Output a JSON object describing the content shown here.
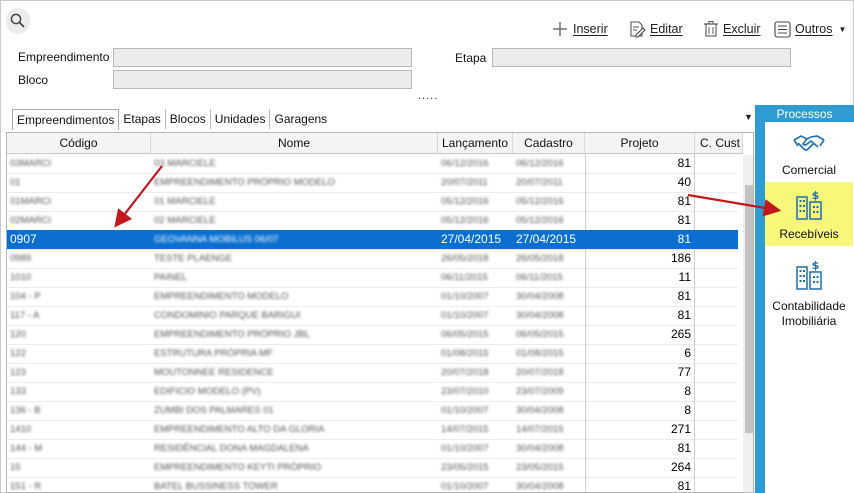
{
  "toolbar": {
    "insert": "Inserir",
    "edit": "Editar",
    "delete": "Excluir",
    "others": "Outros"
  },
  "filters": {
    "empreendimento_label": "Empreendimento",
    "bloco_label": "Bloco",
    "etapa_label": "Etapa",
    "empreendimento_value": "",
    "bloco_value": "",
    "etapa_value": "",
    "expand": "....."
  },
  "tabs": [
    "Empreendimentos",
    "Etapas",
    "Blocos",
    "Unidades",
    "Garagens"
  ],
  "table": {
    "headers": [
      "Código",
      "Nome",
      "Lançamento",
      "Cadastro",
      "Projeto",
      "C. Cust"
    ],
    "rows": [
      {
        "codigo": "03MARCI",
        "nome": "03 MARCIELE",
        "lancamento": "06/12/2016",
        "cadastro": "06/12/2016",
        "projeto": "81"
      },
      {
        "codigo": "01",
        "nome": "EMPREENDIMENTO PRÓPRIO MODELO",
        "lancamento": "20/07/2011",
        "cadastro": "20/07/2011",
        "projeto": "40"
      },
      {
        "codigo": "01MARCI",
        "nome": "01 MARCIELE",
        "lancamento": "05/12/2016",
        "cadastro": "05/12/2016",
        "projeto": "81"
      },
      {
        "codigo": "02MARCI",
        "nome": "02 MARCIELE",
        "lancamento": "05/12/2016",
        "cadastro": "05/12/2016",
        "projeto": "81"
      },
      {
        "codigo": "0907",
        "nome": "GEOVANNA MOBILUS 06/07",
        "lancamento": "27/04/2015",
        "cadastro": "27/04/2015",
        "projeto": "81",
        "selected": true
      },
      {
        "codigo": "0989",
        "nome": "TESTE PLAENGE",
        "lancamento": "26/05/2018",
        "cadastro": "26/05/2018",
        "projeto": "186"
      },
      {
        "codigo": "1010",
        "nome": "PAINEL",
        "lancamento": "06/11/2015",
        "cadastro": "06/11/2015",
        "projeto": "11"
      },
      {
        "codigo": "104 - P",
        "nome": "EMPREENDIMENTO MODELO",
        "lancamento": "01/10/2007",
        "cadastro": "30/04/2008",
        "projeto": "81"
      },
      {
        "codigo": "117 - A",
        "nome": "CONDOMINIO PARQUE BARIGUI",
        "lancamento": "01/10/2007",
        "cadastro": "30/04/2008",
        "projeto": "81"
      },
      {
        "codigo": "120",
        "nome": "EMPREENDIMENTO PRÓPRIO JBL",
        "lancamento": "06/05/2015",
        "cadastro": "06/05/2015",
        "projeto": "265"
      },
      {
        "codigo": "122",
        "nome": "ESTRUTURA PRÓPRIA MF",
        "lancamento": "01/08/2015",
        "cadastro": "01/08/2015",
        "projeto": "6"
      },
      {
        "codigo": "123",
        "nome": "MOUTONNEE RESIDENCE",
        "lancamento": "20/07/2018",
        "cadastro": "20/07/2018",
        "projeto": "77"
      },
      {
        "codigo": "133",
        "nome": "EDIFICIO MODELO (PV)",
        "lancamento": "23/07/2010",
        "cadastro": "23/07/2009",
        "projeto": "8"
      },
      {
        "codigo": "136 - B",
        "nome": "ZUMBI DOS PALMARES 01",
        "lancamento": "01/10/2007",
        "cadastro": "30/04/2008",
        "projeto": "8"
      },
      {
        "codigo": "1410",
        "nome": "EMPREENDIMENTO ALTO DA GLORIA",
        "lancamento": "14/07/2015",
        "cadastro": "14/07/2015",
        "projeto": "271"
      },
      {
        "codigo": "144 - M",
        "nome": "RESIDÊNCIAL DONA MAGDALENA",
        "lancamento": "01/10/2007",
        "cadastro": "30/04/2008",
        "projeto": "81"
      },
      {
        "codigo": "15",
        "nome": "EMPREENDIMENTO KEYTI PRÓPRIO",
        "lancamento": "23/05/2015",
        "cadastro": "23/05/2015",
        "projeto": "264"
      },
      {
        "codigo": "151 - R",
        "nome": "BATEL BUSSINESS TOWER",
        "lancamento": "01/10/2007",
        "cadastro": "30/04/2008",
        "projeto": "81"
      }
    ]
  },
  "processos": {
    "title": "Processos",
    "items": [
      {
        "label": "Comercial",
        "icon": "handshake-icon"
      },
      {
        "label": "Recebíveis",
        "icon": "building-money-icon",
        "highlighted": true
      },
      {
        "label": "Contabilidade Imobiliária",
        "icon": "building-money-icon"
      }
    ]
  },
  "colors": {
    "selection": "#0a6fd1",
    "panel": "#2e9cd2",
    "highlight": "#f7f77a",
    "annotation_arrow": "#c0181c"
  }
}
